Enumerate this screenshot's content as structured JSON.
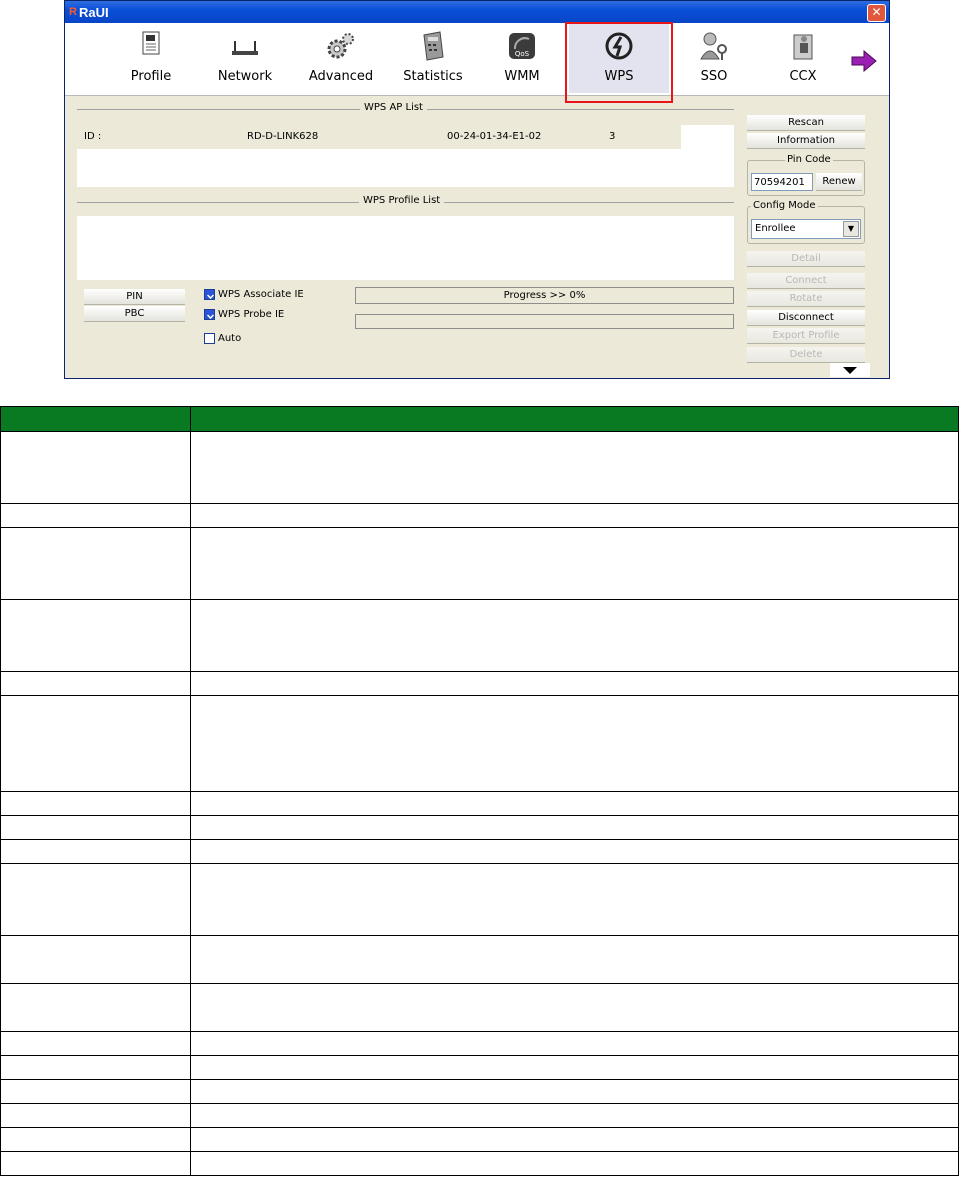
{
  "window": {
    "title": "RaUI",
    "logo_text": "R"
  },
  "toolbar": {
    "items": [
      {
        "label": "Profile",
        "icon": "profile-icon"
      },
      {
        "label": "Network",
        "icon": "network-icon"
      },
      {
        "label": "Advanced",
        "icon": "advanced-icon"
      },
      {
        "label": "Statistics",
        "icon": "statistics-icon"
      },
      {
        "label": "WMM",
        "icon": "wmm-icon"
      },
      {
        "label": "WPS",
        "icon": "wps-icon",
        "active": true
      },
      {
        "label": "SSO",
        "icon": "sso-icon"
      },
      {
        "label": "CCX",
        "icon": "ccx-icon"
      }
    ],
    "next_icon": "next-arrow-icon"
  },
  "wps_ap_list": {
    "label": "WPS AP List",
    "row": {
      "id_label": "ID :",
      "ssid": "RD-D-LINK628",
      "bssid": "00-24-01-34-E1-02",
      "channel": "3"
    }
  },
  "wps_profile_list": {
    "label": "WPS Profile List"
  },
  "buttons": {
    "pin": "PIN",
    "pbc": "PBC",
    "rescan": "Rescan",
    "information": "Information",
    "renew": "Renew",
    "detail": "Detail",
    "connect": "Connect",
    "rotate": "Rotate",
    "disconnect": "Disconnect",
    "export_profile": "Export Profile",
    "delete": "Delete"
  },
  "pin_code": {
    "label": "Pin Code",
    "value": "70594201"
  },
  "config_mode": {
    "label": "Config Mode",
    "selected": "Enrollee"
  },
  "checkboxes": {
    "associate_ie": {
      "label": "WPS Associate IE",
      "checked": true
    },
    "probe_ie": {
      "label": "WPS Probe IE",
      "checked": true
    },
    "auto": {
      "label": "Auto",
      "checked": false
    }
  },
  "progress": {
    "text": "Progress >> 0%",
    "value": 0
  },
  "colors": {
    "table_header": "#0a7a22",
    "highlight": "#e8161a",
    "titlebar": "#0a4fd8"
  },
  "table": {
    "row_heights": [
      72,
      24,
      72,
      72,
      24,
      96,
      24,
      24,
      24,
      72,
      48,
      48,
      24,
      24,
      24,
      24,
      24,
      24
    ]
  }
}
